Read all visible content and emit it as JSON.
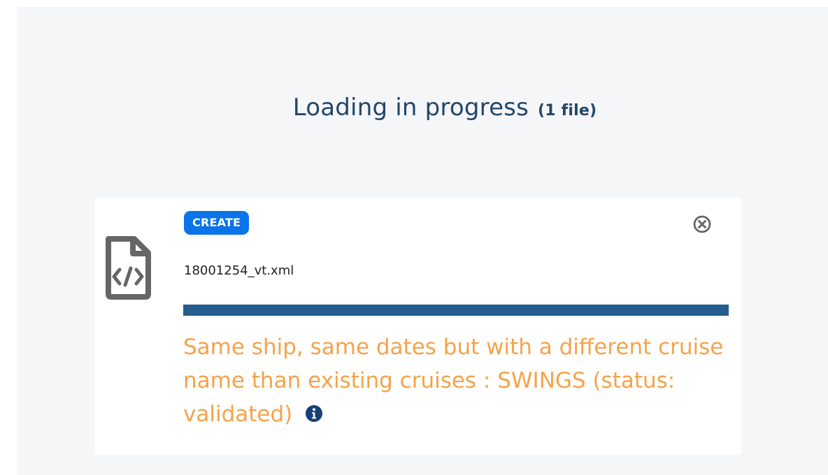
{
  "page": {
    "title": "Loading in progress",
    "file_count": "(1 file)"
  },
  "file_card": {
    "badge": "CREATE",
    "filename": "18001254_vt.xml",
    "progress": 1.0,
    "message": "Same ship, same dates but with a different cruise name than existing cruises : SWINGS (status: validated)",
    "icons": {
      "file": "xml-file-icon",
      "close": "close-circle-icon",
      "info": "info-icon"
    }
  },
  "colors": {
    "title": "#23466b",
    "badge": "#0a74e8",
    "progress": "#255d8e",
    "warning": "#f5a34a",
    "info": "#173f76",
    "icon": "#666666"
  }
}
